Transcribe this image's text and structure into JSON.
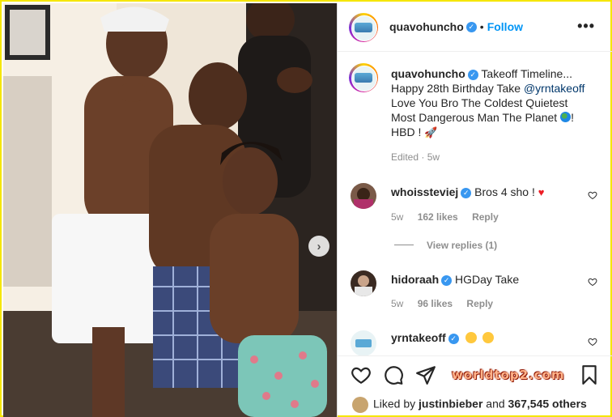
{
  "post": {
    "author": "quavohuncho",
    "follow_label": "Follow",
    "separator": "•",
    "more_label": "•••"
  },
  "caption": {
    "author": "quavohuncho",
    "line1": "Takeoff Timeline...",
    "line2_prefix": "Happy 28th Birthday Take ",
    "mention": "@yrntakeoff",
    "line3": "Love You Bro The Coldest Quietest",
    "line4_prefix": "Most Dangerous Man The Planet ",
    "line4_suffix": "!",
    "line5_prefix": "HBD ! ",
    "edited": "Edited · 5w"
  },
  "comments": [
    {
      "user": "whoissteviej",
      "text": "Bros 4 sho ! ",
      "age": "5w",
      "likes": "162 likes",
      "reply": "Reply"
    },
    {
      "user": "hidoraah",
      "text": "HGDay Take",
      "age": "5w",
      "likes": "96 likes",
      "reply": "Reply"
    },
    {
      "user": "yrntakeoff",
      "text": ""
    }
  ],
  "view_replies": "View replies (1)",
  "watermark": "worldtop2.com",
  "likes": {
    "prefix": "Liked by ",
    "user": "justinbieber",
    "middle": " and ",
    "count": "367,545 others"
  },
  "colors": {
    "accent": "#0095f6",
    "verified": "#3897f0",
    "frame": "#f5e600"
  }
}
